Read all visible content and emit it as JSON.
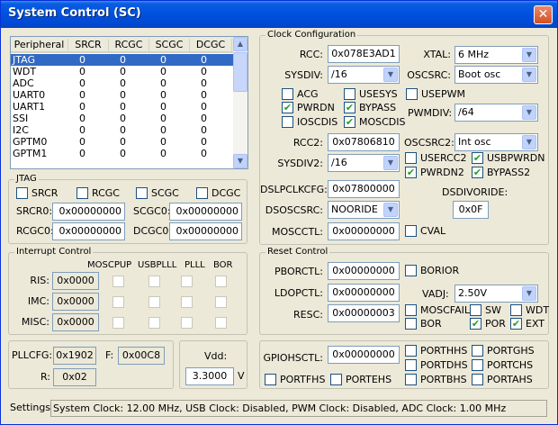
{
  "window": {
    "title": "System Control (SC)",
    "close_glyph": "✕"
  },
  "peripheral_table": {
    "columns": [
      "Peripheral",
      "SRCR",
      "RCGC",
      "SCGC",
      "DCGC"
    ],
    "rows": [
      [
        "JTAG",
        "0",
        "0",
        "0",
        "0"
      ],
      [
        "WDT",
        "0",
        "0",
        "0",
        "0"
      ],
      [
        "ADC",
        "0",
        "0",
        "0",
        "0"
      ],
      [
        "UART0",
        "0",
        "0",
        "0",
        "0"
      ],
      [
        "UART1",
        "0",
        "0",
        "0",
        "0"
      ],
      [
        "SSI",
        "0",
        "0",
        "0",
        "0"
      ],
      [
        "I2C",
        "0",
        "0",
        "0",
        "0"
      ],
      [
        "GPTM0",
        "0",
        "0",
        "0",
        "0"
      ],
      [
        "GPTM1",
        "0",
        "0",
        "0",
        "0"
      ]
    ],
    "selected_index": 0,
    "scroll_up_icon": "▲",
    "scroll_down_icon": "▼"
  },
  "jtag": {
    "legend": "JTAG",
    "checks": [
      {
        "label": "SRCR",
        "checked": false
      },
      {
        "label": "RCGC",
        "checked": false
      },
      {
        "label": "SCGC",
        "checked": false
      },
      {
        "label": "DCGC",
        "checked": false
      }
    ],
    "srcr0_label": "SRCR0:",
    "srcr0_value": "0x00000000",
    "scgc0_label": "SCGC0:",
    "scgc0_value": "0x00000000",
    "rcgc0_label": "RCGC0:",
    "rcgc0_value": "0x00000000",
    "dcgc0_label": "DCGC0:",
    "dcgc0_value": "0x00000000"
  },
  "interrupt": {
    "legend": "Interrupt Control",
    "columns": [
      "MOSCPUP",
      "USBPLLL",
      "PLLL",
      "BOR"
    ],
    "rows": [
      {
        "label": "RIS:",
        "value": "0x0000"
      },
      {
        "label": "IMC:",
        "value": "0x0000"
      },
      {
        "label": "MISC:",
        "value": "0x0000"
      }
    ]
  },
  "pll": {
    "pllcfg_label": "PLLCFG:",
    "pllcfg_value": "0x1902",
    "f_label": "F:",
    "f_value": "0x00C8",
    "r_label": "R:",
    "r_value": "0x02"
  },
  "vdd": {
    "label": "Vdd:",
    "value": "3.3000",
    "unit": "V"
  },
  "clock": {
    "legend": "Clock Configuration",
    "rcc_label": "RCC:",
    "rcc_value": "0x078E3AD1",
    "xtal_label": "XTAL:",
    "xtal_value": "6 MHz",
    "sysdiv_label": "SYSDIV:",
    "sysdiv_value": "/16",
    "oscsrc_label": "OSCSRC:",
    "oscsrc_value": "Boot osc",
    "checks_a": [
      {
        "label": "ACG",
        "checked": false
      },
      {
        "label": "USESYS",
        "checked": false
      },
      {
        "label": "USEPWM",
        "checked": false
      }
    ],
    "checks_b": [
      {
        "label": "PWRDN",
        "checked": true
      },
      {
        "label": "BYPASS",
        "checked": true
      }
    ],
    "checks_c": [
      {
        "label": "IOSCDIS",
        "checked": false
      },
      {
        "label": "MOSCDIS",
        "checked": true
      }
    ],
    "pwmdiv_label": "PWMDIV:",
    "pwmdiv_value": "/64",
    "rcc2_label": "RCC2:",
    "rcc2_value": "0x07806810",
    "oscsrc2_label": "OSCSRC2:",
    "oscsrc2_value": "Int osc",
    "sysdiv2_label": "SYSDIV2:",
    "sysdiv2_value": "/16",
    "checks_rcc2": [
      {
        "label": "USERCC2",
        "checked": false
      },
      {
        "label": "USBPWRDN",
        "checked": true
      },
      {
        "label": "PWRDN2",
        "checked": true
      },
      {
        "label": "BYPASS2",
        "checked": true
      }
    ],
    "dslpclkcfg_label": "DSLPCLKCFG:",
    "dslpclkcfg_value": "0x07800000",
    "dsdivoride_label": "DSDIVORIDE:",
    "dsdivoride_value": "0x0F",
    "dsoscsrc_label": "DSOSCSRC:",
    "dsoscsrc_value": "NOORIDE",
    "moscctl_label": "MOSCCTL:",
    "moscctl_value": "0x00000000",
    "cval_label": "CVAL",
    "cval_checked": false
  },
  "reset": {
    "legend": "Reset Control",
    "pborctl_label": "PBORCTL:",
    "pborctl_value": "0x00000000",
    "borior_label": "BORIOR",
    "borior_checked": false,
    "ldopctl_label": "LDOPCTL:",
    "ldopctl_value": "0x00000000",
    "vadj_label": "VADJ:",
    "vadj_value": "2.50V",
    "resc_label": "RESC:",
    "resc_value": "0x00000003",
    "flags": [
      {
        "label": "MOSCFAIL",
        "checked": false
      },
      {
        "label": "SW",
        "checked": false
      },
      {
        "label": "WDT",
        "checked": false
      },
      {
        "label": "BOR",
        "checked": false
      },
      {
        "label": "POR",
        "checked": true
      },
      {
        "label": "EXT",
        "checked": true
      }
    ]
  },
  "gpio": {
    "gpiohsctl_label": "GPIOHSCTL:",
    "gpiohsctl_value": "0x00000000",
    "ports": [
      {
        "label": "PORTHHS",
        "checked": false
      },
      {
        "label": "PORTGHS",
        "checked": false
      },
      {
        "label": "PORTDHS",
        "checked": false
      },
      {
        "label": "PORTCHS",
        "checked": false
      },
      {
        "label": "PORTBHS",
        "checked": false
      },
      {
        "label": "PORTAHS",
        "checked": false
      },
      {
        "label": "PORTFHS",
        "checked": false
      },
      {
        "label": "PORTEHS",
        "checked": false
      }
    ]
  },
  "settings": {
    "label": "Settings:",
    "text": "System Clock: 12.00 MHz, USB Clock: Disabled, PWM Clock: Disabled, ADC Clock: 1.00 MHz"
  },
  "check_glyph": "✔",
  "dropdown_glyph": "▼"
}
